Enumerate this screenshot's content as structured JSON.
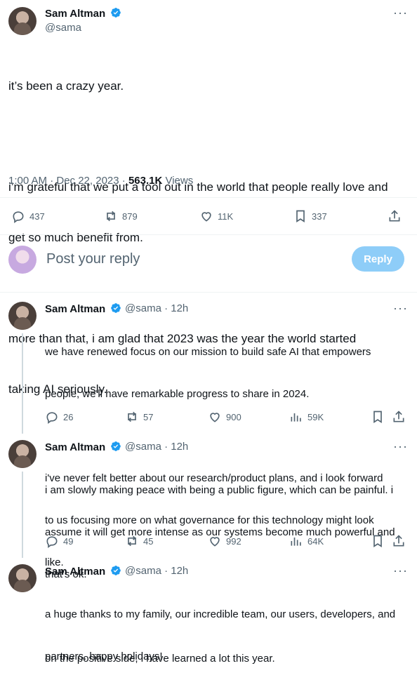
{
  "main_tweet": {
    "name": "Sam Altman",
    "handle": "@sama",
    "text_lines": [
      "it’s been a crazy year.",
      "",
      "i’m grateful that we put a tool out in the world that people really love and",
      "get so much benefit from.",
      "",
      "more than that, i am glad that 2023 was the year the world started",
      "taking AI seriously."
    ],
    "timestamp": "1:00 AM · Dec 22, 2023 ·",
    "views_count": "563.1K",
    "views_label": "Views",
    "replies": "437",
    "reposts": "879",
    "likes": "11K",
    "bookmarks": "337"
  },
  "reply_box": {
    "placeholder": "Post your reply",
    "button": "Reply"
  },
  "replies": [
    {
      "name": "Sam Altman",
      "handle": "@sama · 12h",
      "text_lines": [
        "we have renewed focus on our mission to build safe AI that empowers",
        "people; we'll have remarkable progress to share in 2024.",
        "",
        "i've never felt better about our research/product plans, and i look forward",
        "to us focusing more on what governance for this technology might look",
        "like."
      ],
      "stats": {
        "replies": "26",
        "reposts": "57",
        "likes": "900",
        "views": "59K"
      }
    },
    {
      "name": "Sam Altman",
      "handle": "@sama · 12h",
      "text_lines": [
        "i am slowly making peace with being a public figure, which can be painful. i",
        "assume it will get more intense as our systems become much powerful and",
        "that's ok.",
        "",
        "on the positive side, i have learned a lot this year."
      ],
      "stats": {
        "replies": "49",
        "reposts": "45",
        "likes": "992",
        "views": "64K"
      }
    },
    {
      "name": "Sam Altman",
      "handle": "@sama · 12h",
      "text_lines": [
        "a huge thanks to my family, our incredible team, our users, developers, and",
        "partners. happy holidays!"
      ]
    }
  ],
  "colors": {
    "accent": "#1d9bf0",
    "muted": "#536471",
    "reply_button_disabled": "#8ecdf8"
  },
  "icons": [
    "verified-badge-icon",
    "more-icon",
    "reply-icon",
    "repost-icon",
    "like-icon",
    "views-icon",
    "bookmark-icon",
    "share-icon"
  ]
}
